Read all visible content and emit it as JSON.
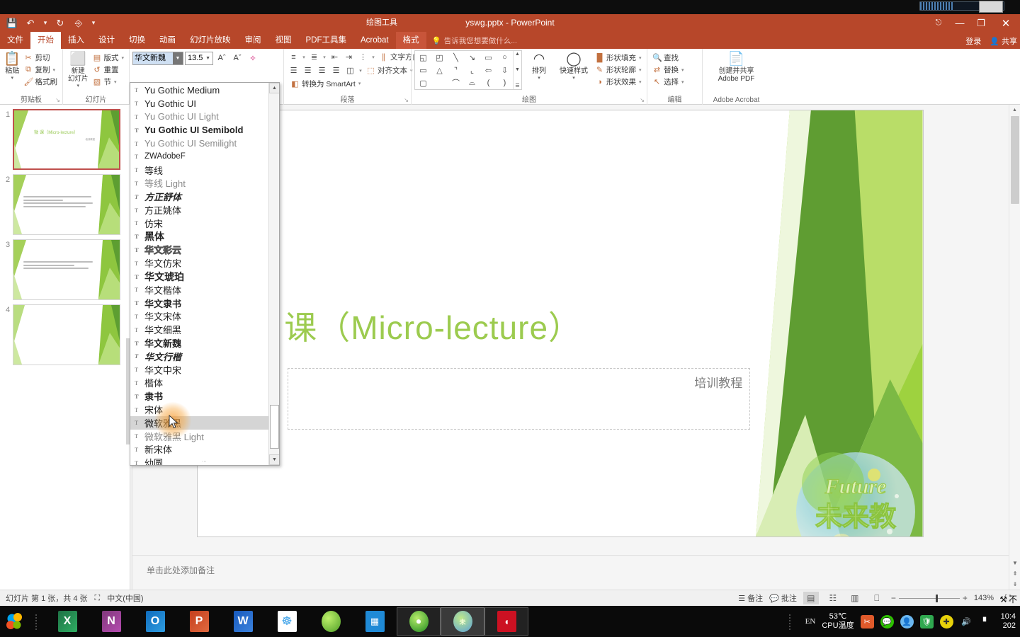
{
  "window": {
    "title": "yswg.pptx - PowerPoint",
    "context_tab_title": "绘图工具",
    "quick_access": [
      {
        "name": "save",
        "glyph": "⬜"
      },
      {
        "name": "undo",
        "glyph": "↩"
      },
      {
        "name": "redo",
        "glyph": "↻"
      },
      {
        "name": "start-slideshow",
        "glyph": "▶"
      },
      {
        "name": "customize-qat",
        "glyph": "▾"
      }
    ],
    "controls": {
      "ribbon_display": "⬚",
      "minimize": "—",
      "restore": "❐",
      "close": "✕"
    },
    "sign_in": "登录",
    "share": "共享",
    "share_icon": "person-icon"
  },
  "tabs": [
    {
      "label": "文件",
      "active": false,
      "ctx": false
    },
    {
      "label": "开始",
      "active": true,
      "ctx": false
    },
    {
      "label": "插入",
      "active": false,
      "ctx": false
    },
    {
      "label": "设计",
      "active": false,
      "ctx": false
    },
    {
      "label": "切换",
      "active": false,
      "ctx": false
    },
    {
      "label": "动画",
      "active": false,
      "ctx": false
    },
    {
      "label": "幻灯片放映",
      "active": false,
      "ctx": false
    },
    {
      "label": "审阅",
      "active": false,
      "ctx": false
    },
    {
      "label": "视图",
      "active": false,
      "ctx": false
    },
    {
      "label": "PDF工具集",
      "active": false,
      "ctx": false
    },
    {
      "label": "Acrobat",
      "active": false,
      "ctx": false
    },
    {
      "label": "格式",
      "active": false,
      "ctx": true
    }
  ],
  "tell_me": {
    "icon": "lightbulb-icon",
    "placeholder": "告诉我您想要做什么..."
  },
  "ribbon": {
    "groups": [
      {
        "name": "clipboard",
        "label": "剪贴板",
        "big": {
          "label": "粘贴",
          "glyph": "📋",
          "caret": "▾"
        },
        "small": [
          {
            "label": "剪切",
            "glyph": "✂"
          },
          {
            "label": "复制",
            "glyph": "⧉",
            "caret": "▾"
          },
          {
            "label": "格式刷",
            "glyph": "🖌"
          }
        ],
        "dialog_launcher": "↘"
      },
      {
        "name": "slides",
        "label": "幻灯片",
        "big": {
          "label": "新建\n幻灯片",
          "glyph": "⬜",
          "caret": "▾"
        },
        "small": [
          {
            "label": "版式",
            "glyph": "▤",
            "caret": "▾"
          },
          {
            "label": "重置",
            "glyph": "↺"
          },
          {
            "label": "节",
            "glyph": "▧",
            "caret": "▾"
          }
        ]
      },
      {
        "name": "font",
        "label": "字体",
        "font_name": "华文新魏",
        "font_size": "13.5",
        "buttons": [
          {
            "name": "grow-font",
            "glyph": "A˄"
          },
          {
            "name": "shrink-font",
            "glyph": "A˅"
          },
          {
            "name": "clear-formatting",
            "glyph": "🧹"
          },
          {
            "name": "bold",
            "glyph": "B"
          },
          {
            "name": "italic",
            "glyph": "I"
          },
          {
            "name": "underline",
            "glyph": "U"
          },
          {
            "name": "text-shadow",
            "glyph": "S"
          },
          {
            "name": "strikethrough",
            "glyph": "abc"
          },
          {
            "name": "character-spacing",
            "glyph": "AV"
          },
          {
            "name": "change-case",
            "glyph": "Aa"
          },
          {
            "name": "font-color",
            "glyph": "A"
          }
        ]
      },
      {
        "name": "paragraph",
        "label": "段落",
        "small": [
          {
            "label": "文字方向",
            "glyph": "∥",
            "caret": "▾"
          },
          {
            "label": "对齐文本",
            "glyph": "⬚",
            "caret": "▾"
          },
          {
            "label": "转换为 SmartArt",
            "glyph": "◧",
            "caret": "▾"
          }
        ],
        "dialog_launcher": "↘"
      },
      {
        "name": "drawing",
        "label": "绘图",
        "shapes": [
          "◱",
          "◰",
          "╲",
          "↘",
          "▭",
          "○",
          "▭",
          "△",
          "⌐",
          "↰",
          "⇨",
          "⇩",
          "▭",
          "⌇",
          "⌒",
          "⌓",
          "(",
          ")"
        ],
        "arrange": {
          "label": "排列",
          "glyph": "◰",
          "caret": "▾"
        },
        "quick_styles": {
          "label": "快速样式",
          "glyph": "◯",
          "caret": "▾"
        },
        "small": [
          {
            "label": "形状填充",
            "glyph": "🪣",
            "caret": "▾"
          },
          {
            "label": "形状轮廓",
            "glyph": "✎",
            "caret": "▾"
          },
          {
            "label": "形状效果",
            "glyph": "◑",
            "caret": "▾"
          }
        ],
        "dialog_launcher": "↘"
      },
      {
        "name": "editing",
        "label": "编辑",
        "small": [
          {
            "label": "查找",
            "glyph": "🔍"
          },
          {
            "label": "替换",
            "glyph": "⇄",
            "caret": "▾"
          },
          {
            "label": "选择",
            "glyph": "↖",
            "caret": "▾"
          }
        ]
      },
      {
        "name": "adobe-acrobat",
        "label": "Adobe Acrobat",
        "big": {
          "label": "创建并共享\nAdobe PDF",
          "glyph": "📄"
        }
      }
    ]
  },
  "font_dropdown": {
    "highlighted": "微软雅黑",
    "scroll_up": "▲",
    "scroll_down": "▼",
    "grip": "⋯",
    "items": [
      {
        "label": "Yu Gothic Medium",
        "style": "sans"
      },
      {
        "label": "Yu Gothic UI",
        "style": "sans"
      },
      {
        "label": "Yu Gothic UI Light",
        "style": "light"
      },
      {
        "label": "Yu Gothic UI Semibold",
        "style": "bold"
      },
      {
        "label": "Yu Gothic UI Semilight",
        "style": "light"
      },
      {
        "label": "ZWAdobeF",
        "style": "sans-small"
      },
      {
        "label": "等线",
        "style": "sans"
      },
      {
        "label": "等线 Light",
        "style": "light"
      },
      {
        "label": "方正舒体",
        "style": "script"
      },
      {
        "label": "方正姚体",
        "style": "serif"
      },
      {
        "label": "仿宋",
        "style": "serif"
      },
      {
        "label": "黑体",
        "style": "bold"
      },
      {
        "label": "华文彩云",
        "style": "outline"
      },
      {
        "label": "华文仿宋",
        "style": "serif"
      },
      {
        "label": "华文琥珀",
        "style": "bold"
      },
      {
        "label": "华文楷体",
        "style": "serif"
      },
      {
        "label": "华文隶书",
        "style": "bold-serif"
      },
      {
        "label": "华文宋体",
        "style": "serif"
      },
      {
        "label": "华文细黑",
        "style": "sans"
      },
      {
        "label": "华文新魏",
        "style": "bold-serif"
      },
      {
        "label": "华文行楷",
        "style": "script"
      },
      {
        "label": "华文中宋",
        "style": "serif"
      },
      {
        "label": "楷体",
        "style": "serif"
      },
      {
        "label": "隶书",
        "style": "bold-serif"
      },
      {
        "label": "宋体",
        "style": "serif"
      },
      {
        "label": "微软雅黑",
        "style": "sans"
      },
      {
        "label": "微软雅黑 Light",
        "style": "light"
      },
      {
        "label": "新宋体",
        "style": "serif"
      },
      {
        "label": "幼圆",
        "style": "sans"
      }
    ]
  },
  "thumbnails": [
    {
      "number": "1",
      "selected": true,
      "title": "微 课（Micro-lecture）",
      "subtitle": "培训教程",
      "lines": 0
    },
    {
      "number": "2",
      "selected": false,
      "title": "",
      "subtitle": "",
      "lines": 4
    },
    {
      "number": "3",
      "selected": false,
      "title": "",
      "subtitle": "",
      "lines": 3
    },
    {
      "number": "4",
      "selected": false,
      "title": "",
      "subtitle": "",
      "lines": 0
    }
  ],
  "slide": {
    "title": "微 课（Micro-lecture）",
    "subtitle": "培训教程",
    "title_color": "#9ccb4f",
    "logo_top_text": "Future",
    "logo_bottom_text": "未来教育"
  },
  "notes": {
    "placeholder": "单击此处添加备注"
  },
  "status_bar": {
    "slide_info": "幻灯片 第 1 张，共 4 张",
    "accessibility_icon": "accessibility-icon",
    "language": "中文(中国)",
    "notes_label": "备注",
    "notes_icon": "notes-icon",
    "comments_label": "批注",
    "comments_icon": "comment-icon",
    "views": [
      {
        "name": "normal-view",
        "glyph": "▤",
        "active": true
      },
      {
        "name": "slide-sorter-view",
        "glyph": "∷",
        "active": false
      },
      {
        "name": "reading-view",
        "glyph": "▥",
        "active": false
      },
      {
        "name": "slideshow-view",
        "glyph": "△",
        "active": false
      }
    ],
    "zoom_out": "−",
    "zoom_in": "+",
    "zoom_level": "143%",
    "fit_window_icon": "fit-slide-icon"
  },
  "tool_watermark": {
    "icon": "⚒",
    "text": "不"
  },
  "taskbar": {
    "start_icon": "windows-start-icon",
    "items": [
      {
        "name": "excel",
        "letter": "X",
        "color": "#1e7145",
        "running": false
      },
      {
        "name": "onenote",
        "letter": "N",
        "color": "#80397b",
        "running": false
      },
      {
        "name": "outlook",
        "letter": "O",
        "color": "#0f6cbd",
        "running": false
      },
      {
        "name": "powerpoint",
        "letter": "P",
        "color": "#c43e1c",
        "running": false
      },
      {
        "name": "word",
        "letter": "W",
        "color": "#185abd",
        "running": false
      },
      {
        "name": "wps-cloud",
        "letter": "☸",
        "color": "#ffffff",
        "running": false
      },
      {
        "name": "green-browser",
        "letter": "◯",
        "color": "#6cc24a",
        "running": false
      },
      {
        "name": "video-editor",
        "letter": "▦",
        "color": "#1f8ad6",
        "running": false
      },
      {
        "name": "recorder",
        "letter": "◉",
        "color": "#3aa33a",
        "running": true
      },
      {
        "name": "future-education",
        "letter": "❀",
        "color": "#5aa0d8",
        "running": true,
        "active": true
      },
      {
        "name": "media-player",
        "letter": "◖",
        "color": "#cc1122",
        "running": true
      }
    ],
    "tray": {
      "language": "EN",
      "cpu_temp": "53℃",
      "cpu_label": "CPU温度",
      "icons": [
        {
          "name": "screenshot-tool-icon",
          "glyph": "✂",
          "color": "#e05a2b"
        },
        {
          "name": "wechat-icon",
          "glyph": "●",
          "color": "#2dc100"
        },
        {
          "name": "qq-icon",
          "glyph": "◑",
          "color": "#6ab7f0"
        },
        {
          "name": "security-shield-icon",
          "glyph": "⛨",
          "color": "#2fa84f"
        },
        {
          "name": "update-icon",
          "glyph": "⊕",
          "color": "#e8d20a"
        },
        {
          "name": "volume-icon",
          "glyph": "🔊",
          "color": "#ffffff"
        },
        {
          "name": "network-icon",
          "glyph": "▃",
          "color": "#ffffff"
        }
      ],
      "time": "10:4",
      "date": "202"
    }
  }
}
